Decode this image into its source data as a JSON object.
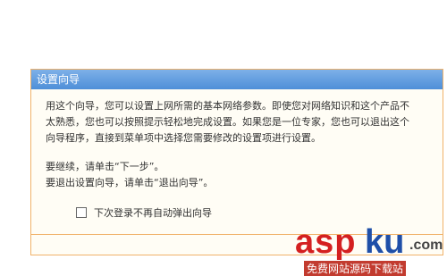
{
  "dialog": {
    "title": "设置向导",
    "intro": "用这个向导，您可以设置上网所需的基本网络参数。即使您对网络知识和这个产品不太熟悉，您也可以按照提示轻松地完成设置。如果您是一位专家，您也可以退出这个向导程序，直接到菜单项中选择您需要修改的设置项进行设置。",
    "continue_hint": "要继续，请单击“下一步”。",
    "exit_hint": "要退出设置向导，请单击“退出向导”。",
    "checkbox_label": "下次登录不再自动弹出向导",
    "checkbox_checked": false
  },
  "watermark": {
    "brand_part1": "asp",
    "brand_part2": "ku",
    "brand_suffix": ".com",
    "tagline": "免费网站源码下载站"
  }
}
